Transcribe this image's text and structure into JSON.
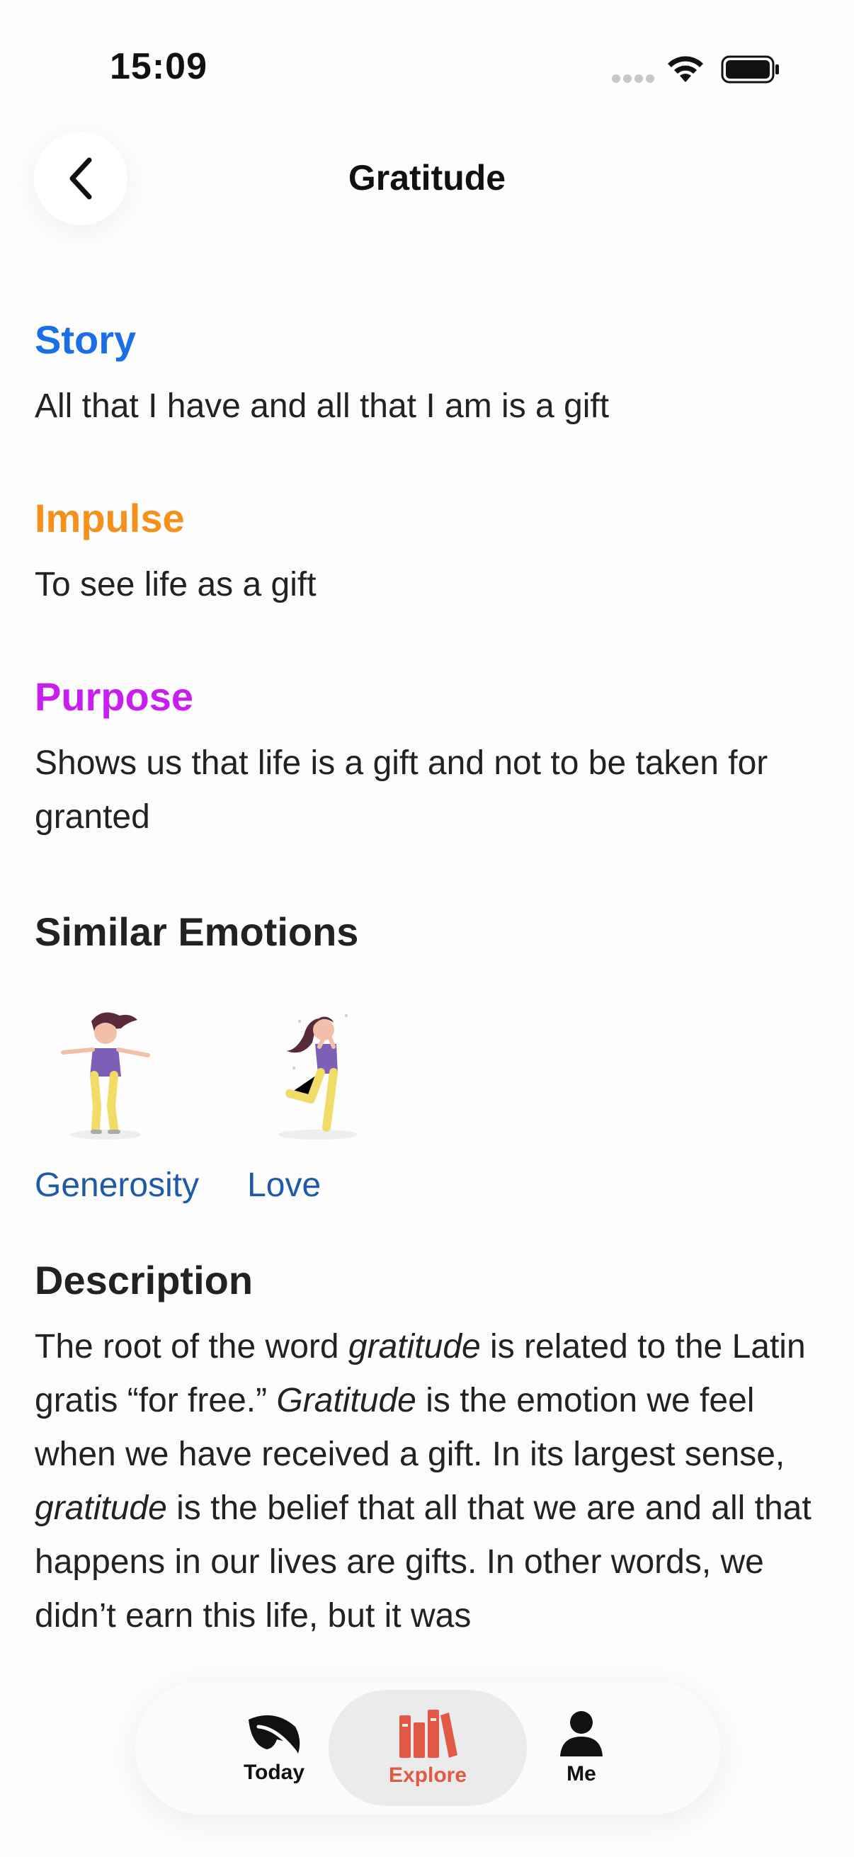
{
  "status": {
    "time": "15:09"
  },
  "header": {
    "title": "Gratitude"
  },
  "sections": {
    "story": {
      "title": "Story",
      "text": "All that I have and all that I am is a gift"
    },
    "impulse": {
      "title": "Impulse",
      "text": "To see life as a gift"
    },
    "purpose": {
      "title": "Purpose",
      "text": "Shows us that life is a gift and not to be taken for granted"
    }
  },
  "similar": {
    "title": "Similar Emotions",
    "items": [
      {
        "label": "Generosity"
      },
      {
        "label": "Love"
      }
    ]
  },
  "description": {
    "title": "Description",
    "p1": "The root of the word ",
    "em1": "gratitude",
    "p2": " is related to the Latin gratis “for free.” ",
    "em2": "Gratitude",
    "p3": " is the emotion we feel when we have received a gift. In its largest sense, ",
    "em3": "gratitude",
    "p4": " is the belief that all that we are and all that happens in our lives are gifts. In other words, we didn’t earn this life, but it was"
  },
  "tabbar": {
    "tabs": [
      {
        "label": "Today",
        "icon": "leaf-icon"
      },
      {
        "label": "Explore",
        "icon": "books-icon"
      },
      {
        "label": "Me",
        "icon": "person-icon"
      }
    ],
    "active": "Explore"
  },
  "colors": {
    "story": "#1a6fe6",
    "impulse": "#f5901a",
    "purpose": "#c81ef0",
    "link": "#1e5aa8",
    "accent": "#e05a45"
  }
}
